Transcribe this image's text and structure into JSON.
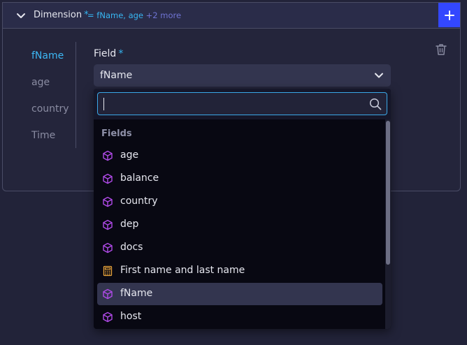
{
  "header": {
    "title": "Dimension",
    "required_mark": "*",
    "summary": "= fName, age",
    "more": "+2 more",
    "add_label": "+"
  },
  "tabs": [
    {
      "label": "fName",
      "active": true
    },
    {
      "label": "age",
      "active": false
    },
    {
      "label": "country",
      "active": false
    },
    {
      "label": "Time",
      "active": false
    }
  ],
  "field": {
    "label": "Field",
    "required_mark": "*",
    "value": "fName"
  },
  "dropdown": {
    "search_value": "",
    "group_label": "Fields",
    "items": [
      {
        "label": "age",
        "icon": "cube-icon"
      },
      {
        "label": "balance",
        "icon": "cube-icon"
      },
      {
        "label": "country",
        "icon": "cube-icon"
      },
      {
        "label": "dep",
        "icon": "cube-icon"
      },
      {
        "label": "docs",
        "icon": "cube-icon"
      },
      {
        "label": "First name and last name",
        "icon": "calculator-icon"
      },
      {
        "label": "fName",
        "icon": "cube-icon",
        "selected": true
      },
      {
        "label": "host",
        "icon": "cube-icon"
      }
    ]
  },
  "colors": {
    "accent": "#3db8f5",
    "add_button": "#3347ff",
    "cube_icon": "#b04ae8",
    "calc_icon": "#e8a33a"
  }
}
